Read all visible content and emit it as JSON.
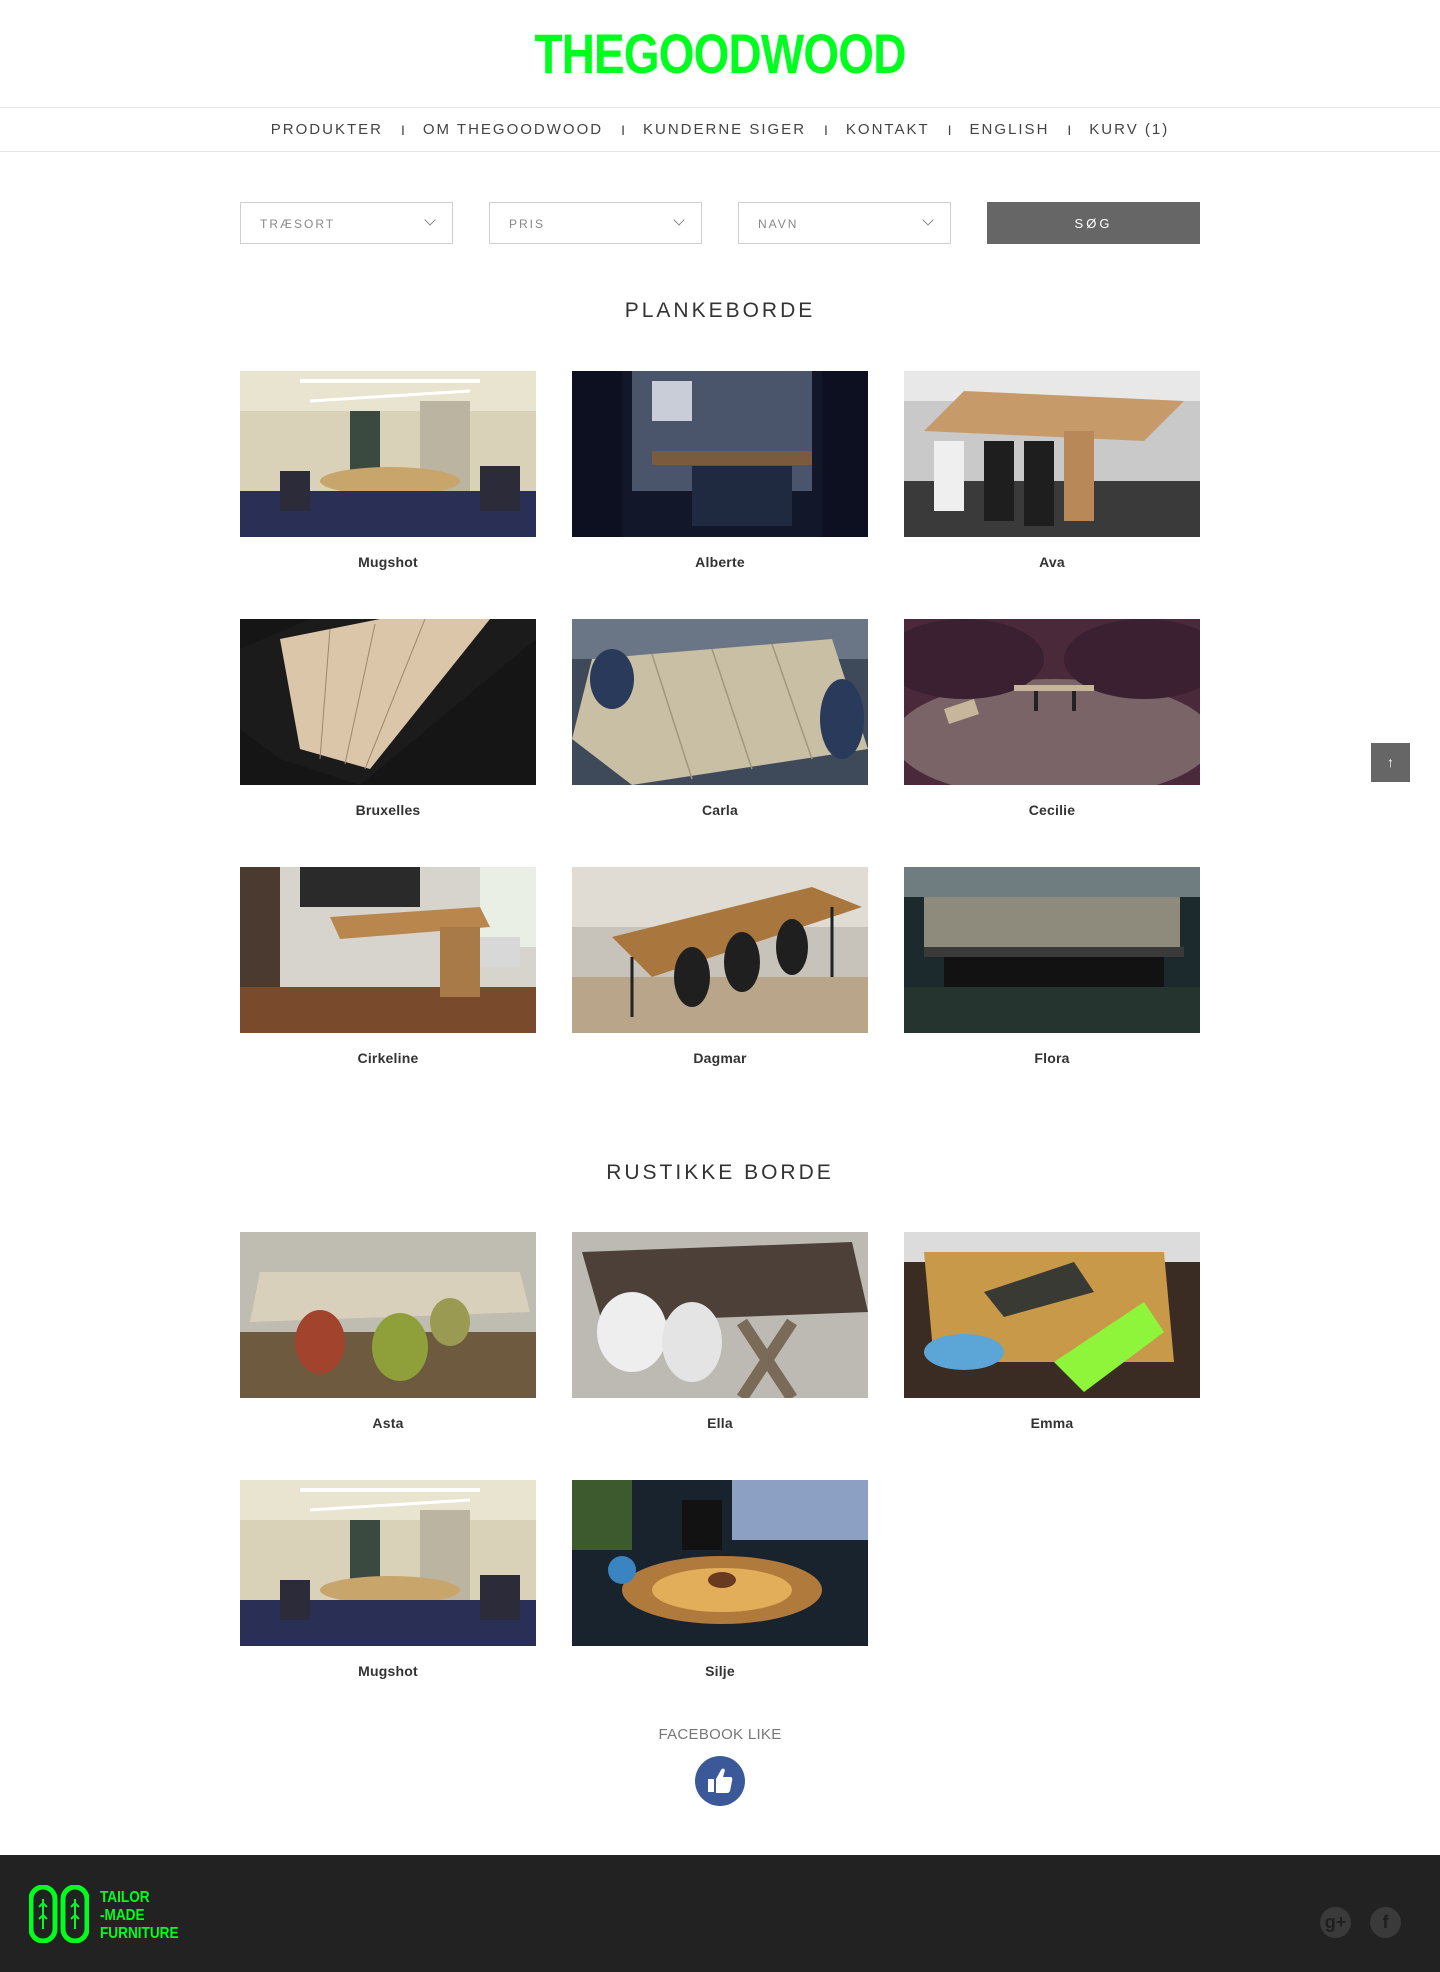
{
  "brand": {
    "logo_text": "THEGOODWOOD",
    "accent_color": "#00ff1e"
  },
  "nav": {
    "items": [
      {
        "label": "PRODUKTER"
      },
      {
        "label": "OM THEGOODWOOD"
      },
      {
        "label": "KUNDERNE SIGER"
      },
      {
        "label": "KONTAKT"
      },
      {
        "label": "ENGLISH"
      },
      {
        "label": "KURV (1)"
      }
    ],
    "separator": "I"
  },
  "filters": {
    "wood_type": "TRÆSORT",
    "price": "PRIS",
    "name": "NAVN",
    "search_label": "SØG"
  },
  "sections": [
    {
      "title": "PLANKEBORDE",
      "products": [
        {
          "name": "Mugshot"
        },
        {
          "name": "Alberte"
        },
        {
          "name": "Ava"
        },
        {
          "name": "Bruxelles"
        },
        {
          "name": "Carla"
        },
        {
          "name": "Cecilie"
        },
        {
          "name": "Cirkeline"
        },
        {
          "name": "Dagmar"
        },
        {
          "name": "Flora"
        }
      ]
    },
    {
      "title": "RUSTIKKE BORDE",
      "products": [
        {
          "name": "Asta"
        },
        {
          "name": "Ella"
        },
        {
          "name": "Emma"
        },
        {
          "name": "Mugshot"
        },
        {
          "name": "Silje"
        }
      ]
    }
  ],
  "facebook": {
    "label": "FACEBOOK LIKE"
  },
  "footer": {
    "tagline_line1": "TAILOR",
    "tagline_line2": "-MADE",
    "tagline_line3": "FURNITURE",
    "social": [
      "google-plus-icon",
      "facebook-icon"
    ]
  },
  "scroll_top": {
    "glyph": "↑"
  }
}
